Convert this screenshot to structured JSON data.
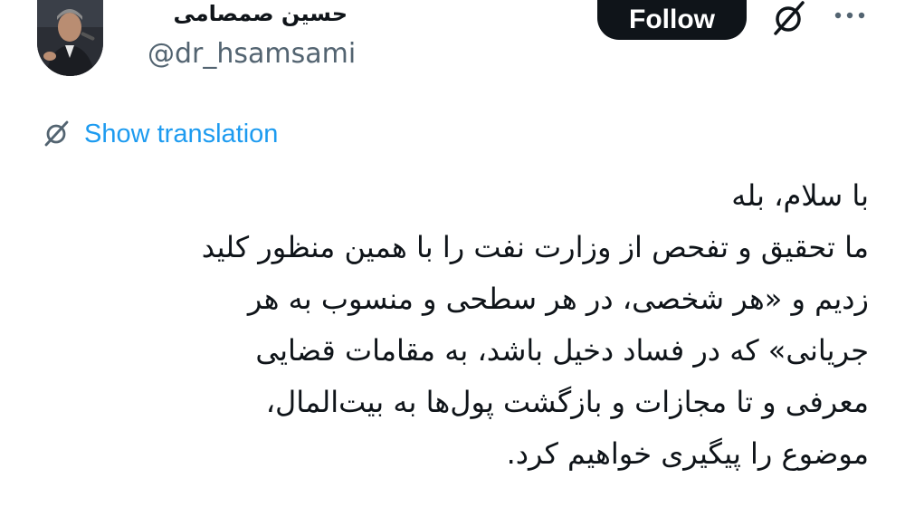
{
  "author": {
    "display_name": "حسین صمصامی",
    "handle": "@dr_hsamsami"
  },
  "actions": {
    "follow_label": "Follow",
    "grok_icon": "grok-icon",
    "more_icon": "more-dots-icon"
  },
  "translation": {
    "label": "Show translation",
    "icon": "grok-icon"
  },
  "tweet": {
    "lines": [
      "با سلام، بله",
      "ما تحقیق و تفحص از وزارت نفت را با همین منظور کلید",
      "زدیم و «هر شخصی، در هر سطحی و منسوب به هر",
      "جریانی» که در فساد دخیل باشد، به مقامات قضایی",
      "معرفی و تا مجازات و بازگشت پول‌ها به بیت‌المال،",
      "موضوع را پیگیری خواهیم کرد."
    ]
  },
  "colors": {
    "text": "#0f1419",
    "secondary": "#536471",
    "link": "#1d9bf0",
    "button": "#0f1419"
  }
}
